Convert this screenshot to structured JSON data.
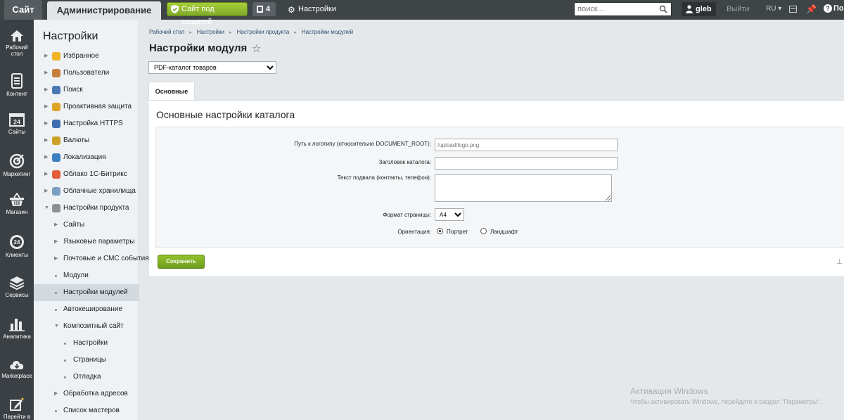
{
  "topbar": {
    "site_tab": "Сайт",
    "admin_tab": "Администрирование",
    "protect_label": "Сайт под защитой",
    "count": "4",
    "settings_label": "Настройки",
    "search_placeholder": "поиск...",
    "user": "gleb",
    "logout": "Выйти",
    "lang": "RU ▾",
    "help": "Пом"
  },
  "rail": {
    "items": [
      {
        "label": "Рабочий стол",
        "icon": "home-icon"
      },
      {
        "label": "Контент",
        "icon": "document-icon"
      },
      {
        "label": "Сайты",
        "icon": "calendar-icon"
      },
      {
        "label": "Маркетинг",
        "icon": "target-icon"
      },
      {
        "label": "Магазин",
        "icon": "basket-icon"
      },
      {
        "label": "Клиенты",
        "icon": "clients-icon"
      },
      {
        "label": "Сервисы",
        "icon": "layers-icon"
      },
      {
        "label": "Аналитика",
        "icon": "chart-icon"
      },
      {
        "label": "Marketplace",
        "icon": "cloud-icon"
      },
      {
        "label": "Перейти в",
        "icon": "edit-icon"
      }
    ],
    "calendar_num": "24",
    "clients_num": "24"
  },
  "menu": {
    "title": "Настройки",
    "items": [
      {
        "label": "Избранное",
        "level": 0
      },
      {
        "label": "Пользователи",
        "level": 0
      },
      {
        "label": "Поиск",
        "level": 0
      },
      {
        "label": "Проактивная защита",
        "level": 0
      },
      {
        "label": "Настройка HTTPS",
        "level": 0
      },
      {
        "label": "Валюты",
        "level": 0
      },
      {
        "label": "Локализация",
        "level": 0
      },
      {
        "label": "Облако 1С-Битрикс",
        "level": 0
      },
      {
        "label": "Облачные хранилища",
        "level": 0
      },
      {
        "label": "Настройки продукта",
        "level": 0
      },
      {
        "label": "Сайты",
        "level": 1
      },
      {
        "label": "Языковые параметры",
        "level": 1
      },
      {
        "label": "Почтовые и СМС события",
        "level": 1
      },
      {
        "label": "Модули",
        "level": 1
      },
      {
        "label": "Настройки модулей",
        "level": 1
      },
      {
        "label": "Автокеширование",
        "level": 1
      },
      {
        "label": "Композитный сайт",
        "level": 1
      },
      {
        "label": "Настройки",
        "level": 2
      },
      {
        "label": "Страницы",
        "level": 2
      },
      {
        "label": "Отладка",
        "level": 2
      },
      {
        "label": "Обработка адресов",
        "level": 1
      },
      {
        "label": "Список мастеров",
        "level": 1
      }
    ]
  },
  "breadcrumbs": [
    "Рабочий стол",
    "Настройки",
    "Настройки продукта",
    "Настройки модулей"
  ],
  "page_title": "Настройки модуля",
  "module_select": "PDF-каталог товаров",
  "tab": "Основные",
  "section_title": "Основные настройки каталога",
  "form": {
    "logo_label": "Путь к логотипу (относительно DOCUMENT_ROOT):",
    "logo_placeholder": "/upload/logo.png",
    "title_label": "Заголовок каталога:",
    "title_value": "",
    "footer_label": "Текст подвала (контакты, телефон):",
    "footer_value": "",
    "format_label": "Формат страницы:",
    "format_value": "A4",
    "orientation_label": "Ориентация:",
    "portrait": "Портрет",
    "landscape": "Ландшафт",
    "orientation_selected": "Портрет"
  },
  "save_label": "Сохранить",
  "watermark": {
    "line1": "Активация Windows",
    "line2": "Чтобы активировать Windows, перейдите в раздел \"Параметры\"."
  }
}
